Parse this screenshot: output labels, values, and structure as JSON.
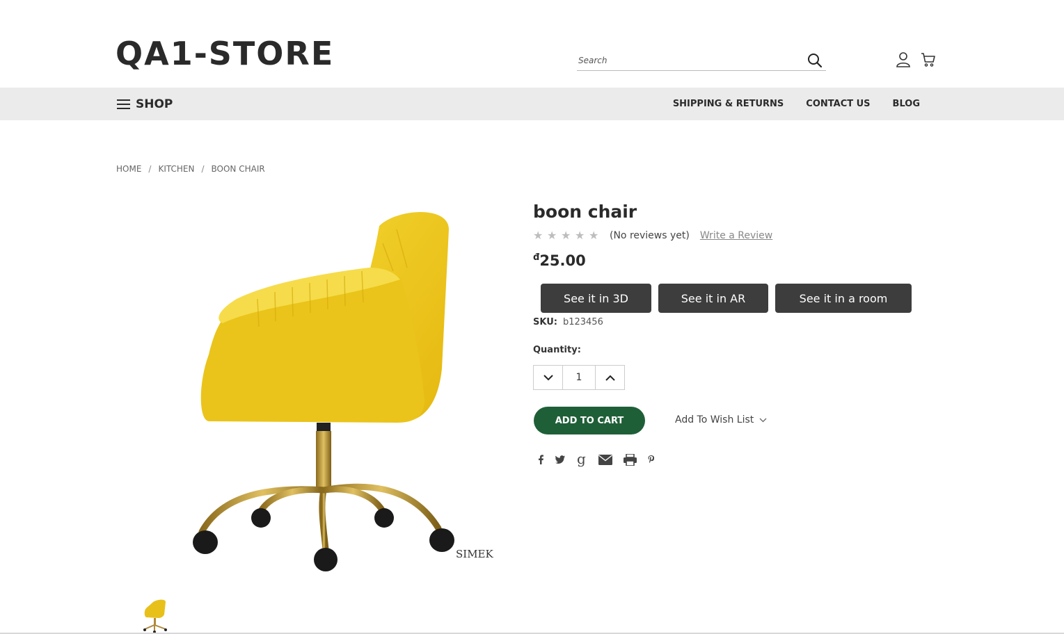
{
  "header": {
    "logo": "QA1-STORE",
    "search_placeholder": "Search",
    "search_icon": "search-icon",
    "account_icon": "user-icon",
    "cart_icon": "cart-icon"
  },
  "nav": {
    "shop_label": "SHOP",
    "links": [
      "SHIPPING & RETURNS",
      "CONTACT US",
      "BLOG"
    ]
  },
  "breadcrumb": [
    "HOME",
    "KITCHEN",
    "BOON CHAIR"
  ],
  "product": {
    "title": "boon chair",
    "rating": 0,
    "rating_max": 5,
    "reviews_text": "(No reviews yet)",
    "write_review": "Write a Review",
    "currency_symbol": "đ",
    "price": "25.00",
    "view_buttons": [
      "See it in 3D",
      "See it in AR",
      "See it in a room"
    ],
    "sku_label": "SKU:",
    "sku": "b123456",
    "quantity_label": "Quantity:",
    "quantity": "1",
    "add_to_cart": "ADD TO CART",
    "wishlist": "Add To Wish List",
    "image_watermark": "SIMEK",
    "share_icons": [
      "facebook-icon",
      "twitter-icon",
      "google-icon",
      "email-icon",
      "print-icon",
      "pinterest-icon"
    ]
  },
  "colors": {
    "accent_green": "#1f5f38",
    "button_dark": "#3d3d3d",
    "nav_bg": "#ebebeb",
    "chair_yellow": "#f2cc1c",
    "chair_gold": "#c9a23a"
  }
}
